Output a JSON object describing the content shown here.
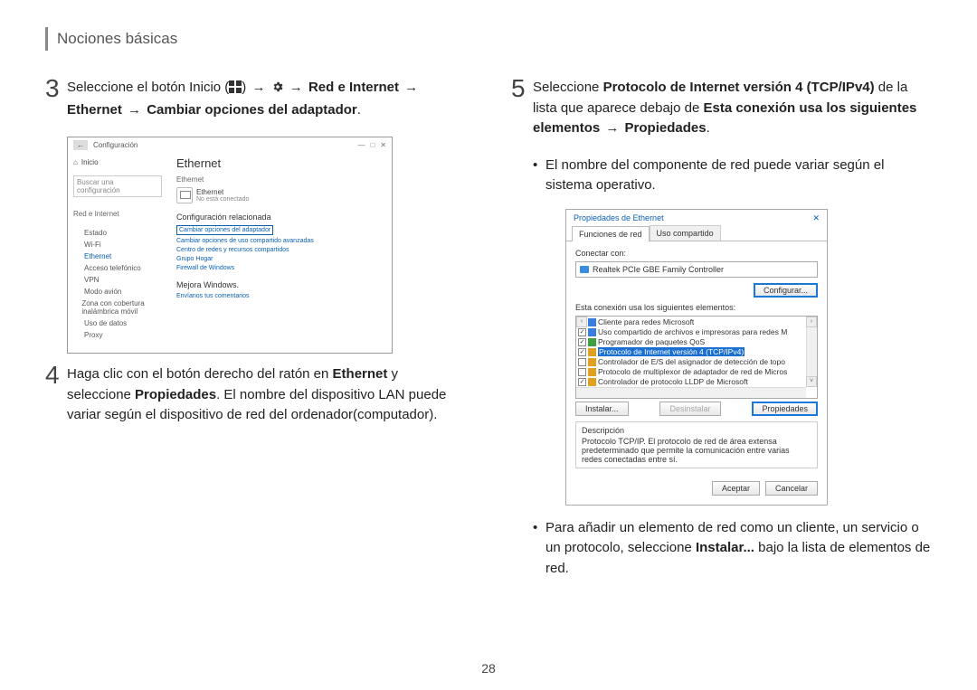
{
  "header": "Nociones básicas",
  "page_number": "28",
  "left": {
    "step3": {
      "num": "3",
      "t1": "Seleccione el botón Inicio (",
      "t2": ") ",
      "arrow": "→",
      "t3": " ",
      "t4": " ",
      "t5": "Red e Internet",
      "t6": "Ethernet",
      "t7": "Cambiar opciones del adaptador",
      "period": "."
    },
    "settings": {
      "back": "←",
      "title": "Configuración",
      "win_min": "—",
      "win_max": "□",
      "win_close": "✕",
      "home": "Inicio",
      "search_ph": "Buscar una configuración",
      "category": "Red e Internet",
      "items": [
        {
          "label": "Estado"
        },
        {
          "label": "Wi-Fi"
        },
        {
          "label": "Ethernet",
          "active": true
        },
        {
          "label": "Acceso telefónico"
        },
        {
          "label": "VPN"
        },
        {
          "label": "Modo avión"
        },
        {
          "label": "Zona con cobertura inalámbrica móvil"
        },
        {
          "label": "Uso de datos"
        },
        {
          "label": "Proxy"
        }
      ],
      "main_title": "Ethernet",
      "eth_sub": "Ethernet",
      "eth_status": "No está conectado",
      "section": "Configuración relacionada",
      "links": [
        "Cambiar opciones del adaptador",
        "Cambiar opciones de uso compartido avanzadas",
        "Centro de redes y recursos compartidos",
        "Grupo Hogar",
        "Firewall de Windows"
      ],
      "improve": "Mejora Windows.",
      "feedback": "Envíanos tus comentarios"
    },
    "step4": {
      "num": "4",
      "t1": "Haga clic con el botón derecho del ratón en ",
      "t2": "Ethernet",
      "t3": " y seleccione ",
      "t4": "Propiedades",
      "t5": ". El nombre del dispositivo LAN puede variar según el dispositivo de red del ordenador(computador)."
    }
  },
  "right": {
    "step5": {
      "num": "5",
      "t1": "Seleccione ",
      "t2": "Protocolo de Internet versión 4 (TCP/IPv4)",
      "t3": " de la lista que aparece debajo de ",
      "t4": "Esta conexión usa los siguientes elementos",
      "arrow": "→",
      "t5": "Propiedades",
      "period": "."
    },
    "bullet1": "El nombre del componente de red puede variar según el sistema operativo.",
    "dialog": {
      "title": "Propiedades de Ethernet",
      "close": "✕",
      "tab_active": "Funciones de red",
      "tab_inactive": "Uso compartido",
      "connect_with": "Conectar con:",
      "adapter": "Realtek PCIe GBE Family Controller",
      "configure": "Configurar...",
      "uses_label": "Esta conexión usa los siguientes elementos:",
      "items": [
        {
          "checked": true,
          "icon": "blue",
          "label": "Cliente para redes Microsoft"
        },
        {
          "checked": true,
          "icon": "blue",
          "label": "Uso compartido de archivos e impresoras para redes M"
        },
        {
          "checked": true,
          "icon": "green",
          "label": "Programador de paquetes QoS"
        },
        {
          "checked": true,
          "icon": "orange",
          "label": "Protocolo de Internet versión 4 (TCP/IPv4)",
          "selected": true
        },
        {
          "checked": false,
          "icon": "orange",
          "label": "Controlador de E/S del asignador de detección de topo"
        },
        {
          "checked": false,
          "icon": "orange",
          "label": "Protocolo de multiplexor de adaptador de red de Micros"
        },
        {
          "checked": true,
          "icon": "orange",
          "label": "Controlador de protocolo LLDP de Microsoft"
        }
      ],
      "install": "Instalar...",
      "uninstall": "Desinstalar",
      "properties": "Propiedades",
      "desc_label": "Descripción",
      "desc_text": "Protocolo TCP/IP. El protocolo de red de área extensa predeterminado que permite la comunicación entre varias redes conectadas entre sí.",
      "accept": "Aceptar",
      "cancel": "Cancelar"
    },
    "bullet2": {
      "t1": "Para añadir un elemento de red como un cliente, un servicio o un protocolo, seleccione ",
      "t2": "Instalar...",
      "t3": " bajo la lista de elementos de red."
    }
  }
}
